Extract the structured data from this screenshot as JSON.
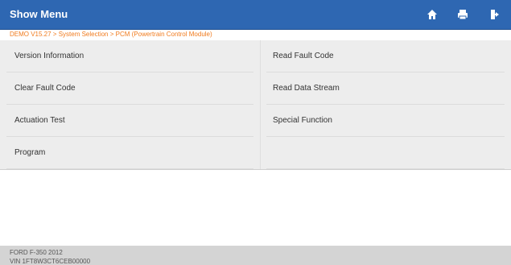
{
  "header": {
    "title": "Show Menu",
    "icons": [
      "home-icon",
      "print-icon",
      "exit-icon"
    ],
    "color": "#2e67b2"
  },
  "breadcrumb": "DEMO V15.27 > System Selection > PCM (Powertrain Control Module)",
  "menu": {
    "items": [
      {
        "label": "Version Information"
      },
      {
        "label": "Read Fault Code"
      },
      {
        "label": "Clear Fault Code"
      },
      {
        "label": "Read Data Stream"
      },
      {
        "label": "Actuation Test"
      },
      {
        "label": "Special Function"
      },
      {
        "label": "Program"
      }
    ]
  },
  "footer": {
    "vehicle": "FORD F-350 2012",
    "vin": "VIN 1FT8W3CT6CEB00000"
  }
}
